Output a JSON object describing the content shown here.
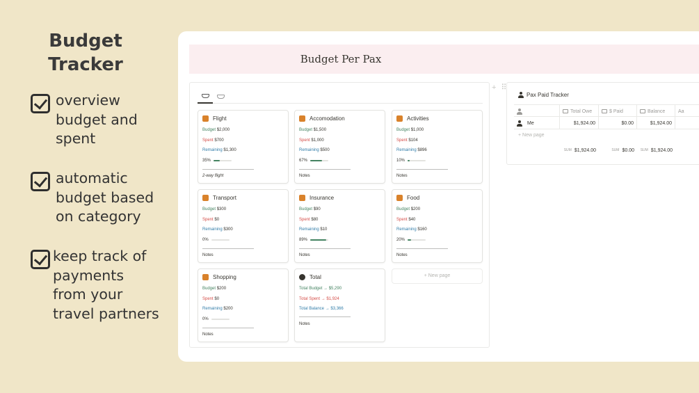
{
  "promo": {
    "title": "Budget Tracker",
    "features": [
      "overview\nbudget and\nspent",
      "automatic\nbudget based\non category",
      "keep track of\npayments\nfrom your\ntravel partners"
    ]
  },
  "page": {
    "title": "Budget Per Pax"
  },
  "gallery": {
    "cards": [
      {
        "name": "Flight",
        "budget": "$2,000",
        "spent": "$700",
        "remaining": "$1,300",
        "percent": "35%",
        "progress": 0.35,
        "notes": "2-way flight",
        "icon": "airplane-icon",
        "color": "#d9822b"
      },
      {
        "name": "Accomodation",
        "budget": "$1,500",
        "spent": "$1,000",
        "remaining": "$500",
        "percent": "67%",
        "progress": 0.67,
        "notes": "Notes",
        "icon": "hotel-icon",
        "color": "#d9822b"
      },
      {
        "name": "Activities",
        "budget": "$1,000",
        "spent": "$104",
        "remaining": "$896",
        "percent": "10%",
        "progress": 0.1,
        "notes": "Notes",
        "icon": "elephant-icon",
        "color": "#d9822b"
      },
      {
        "name": "Transport",
        "budget": "$300",
        "spent": "$0",
        "remaining": "$300",
        "percent": "0%",
        "progress": 0,
        "notes": "Notes",
        "icon": "car-icon",
        "color": "#d9822b"
      },
      {
        "name": "Insurance",
        "budget": "$90",
        "spent": "$80",
        "remaining": "$10",
        "percent": "89%",
        "progress": 0.89,
        "notes": "Notes",
        "icon": "insurance-icon",
        "color": "#d9822b"
      },
      {
        "name": "Food",
        "budget": "$200",
        "spent": "$40",
        "remaining": "$160",
        "percent": "20%",
        "progress": 0.2,
        "notes": "Notes",
        "icon": "food-icon",
        "color": "#d9822b"
      },
      {
        "name": "Shopping",
        "budget": "$200",
        "spent": "$0",
        "remaining": "$200",
        "percent": "0%",
        "progress": 0,
        "notes": "Notes",
        "icon": "shopping-bag-icon",
        "color": "#d9822b"
      }
    ],
    "labels": {
      "budget": "Budget",
      "spent": "Spent",
      "remaining": "Remaining"
    },
    "total": {
      "name": "Total",
      "budget": "Total Budget → $5,290",
      "spent": "Total Spent → $1,924",
      "balance": "Total Balance → $3,366",
      "notes": "Notes"
    },
    "new_page": "+ New page"
  },
  "tracker": {
    "title": "Pax Paid Tracker",
    "columns": [
      "",
      "Total Owe",
      "$ Paid",
      "Balance",
      "Aa"
    ],
    "rows": [
      {
        "name": "Me",
        "total_owe": "$1,924.00",
        "paid": "$0.00",
        "balance": "$1,924.00"
      }
    ],
    "new_page": "+ New page",
    "sum_label": "SUM",
    "sums": {
      "total_owe": "$1,924.00",
      "paid": "$0.00",
      "balance": "$1,924.00"
    }
  }
}
